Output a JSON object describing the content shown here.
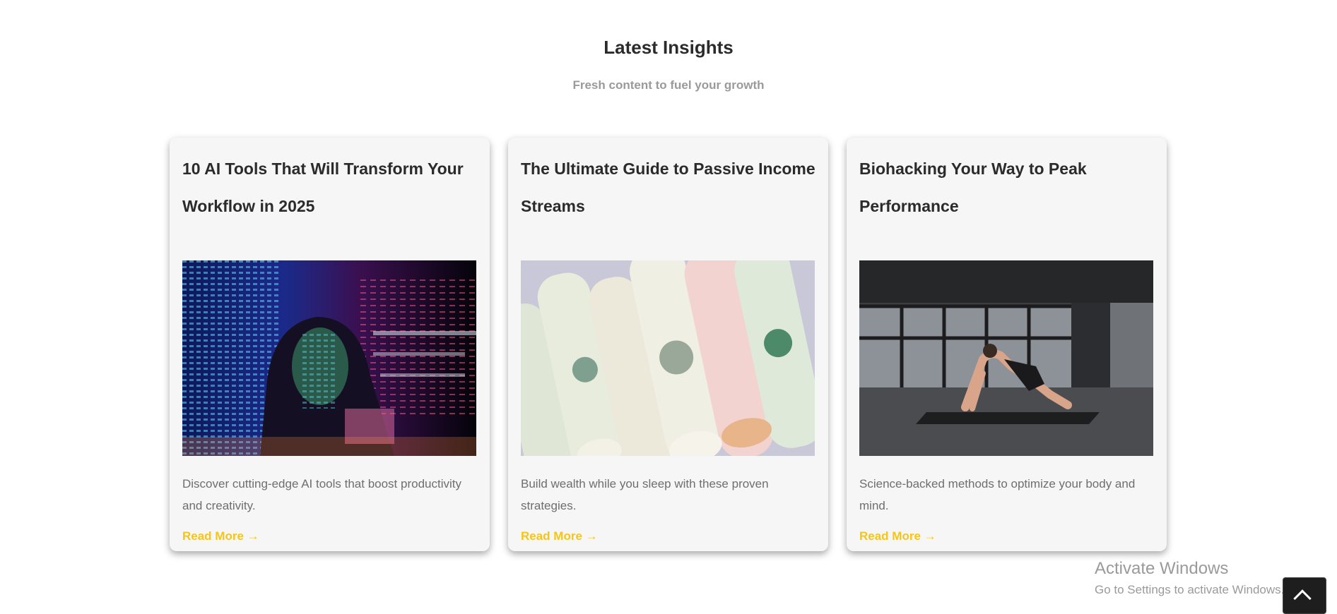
{
  "section": {
    "title": "Latest Insights",
    "subtitle": "Fresh content to fuel your growth"
  },
  "cards": [
    {
      "title": "10 AI Tools That Will Transform Your Workflow in 2025",
      "image": "ai-code-projection-portrait",
      "excerpt": "Discover cutting-edge AI tools that boost productivity and creativity.",
      "link": "Read More →"
    },
    {
      "title": "The Ultimate Guide to Passive Income Streams",
      "image": "rolled-dollar-bills",
      "excerpt": "Build wealth while you sleep with these proven strategies.",
      "link": "Read More →"
    },
    {
      "title": "Biohacking Your Way to Peak Performance",
      "image": "man-doing-plank-in-empty-building",
      "excerpt": "Science-backed methods to optimize your body and mind.",
      "link": "Read More →"
    }
  ],
  "overlay": {
    "activate_title": "Activate Windows",
    "activate_sub": "Go to Settings to activate Windows."
  },
  "colors": {
    "accent": "#f5c518",
    "card_bg": "#f6f6f6",
    "title": "#2b2b2b",
    "muted": "#6e6e6e"
  },
  "icons": {
    "scroll_top": "chevron-up-icon",
    "link_arrow": "arrow-right-icon"
  }
}
